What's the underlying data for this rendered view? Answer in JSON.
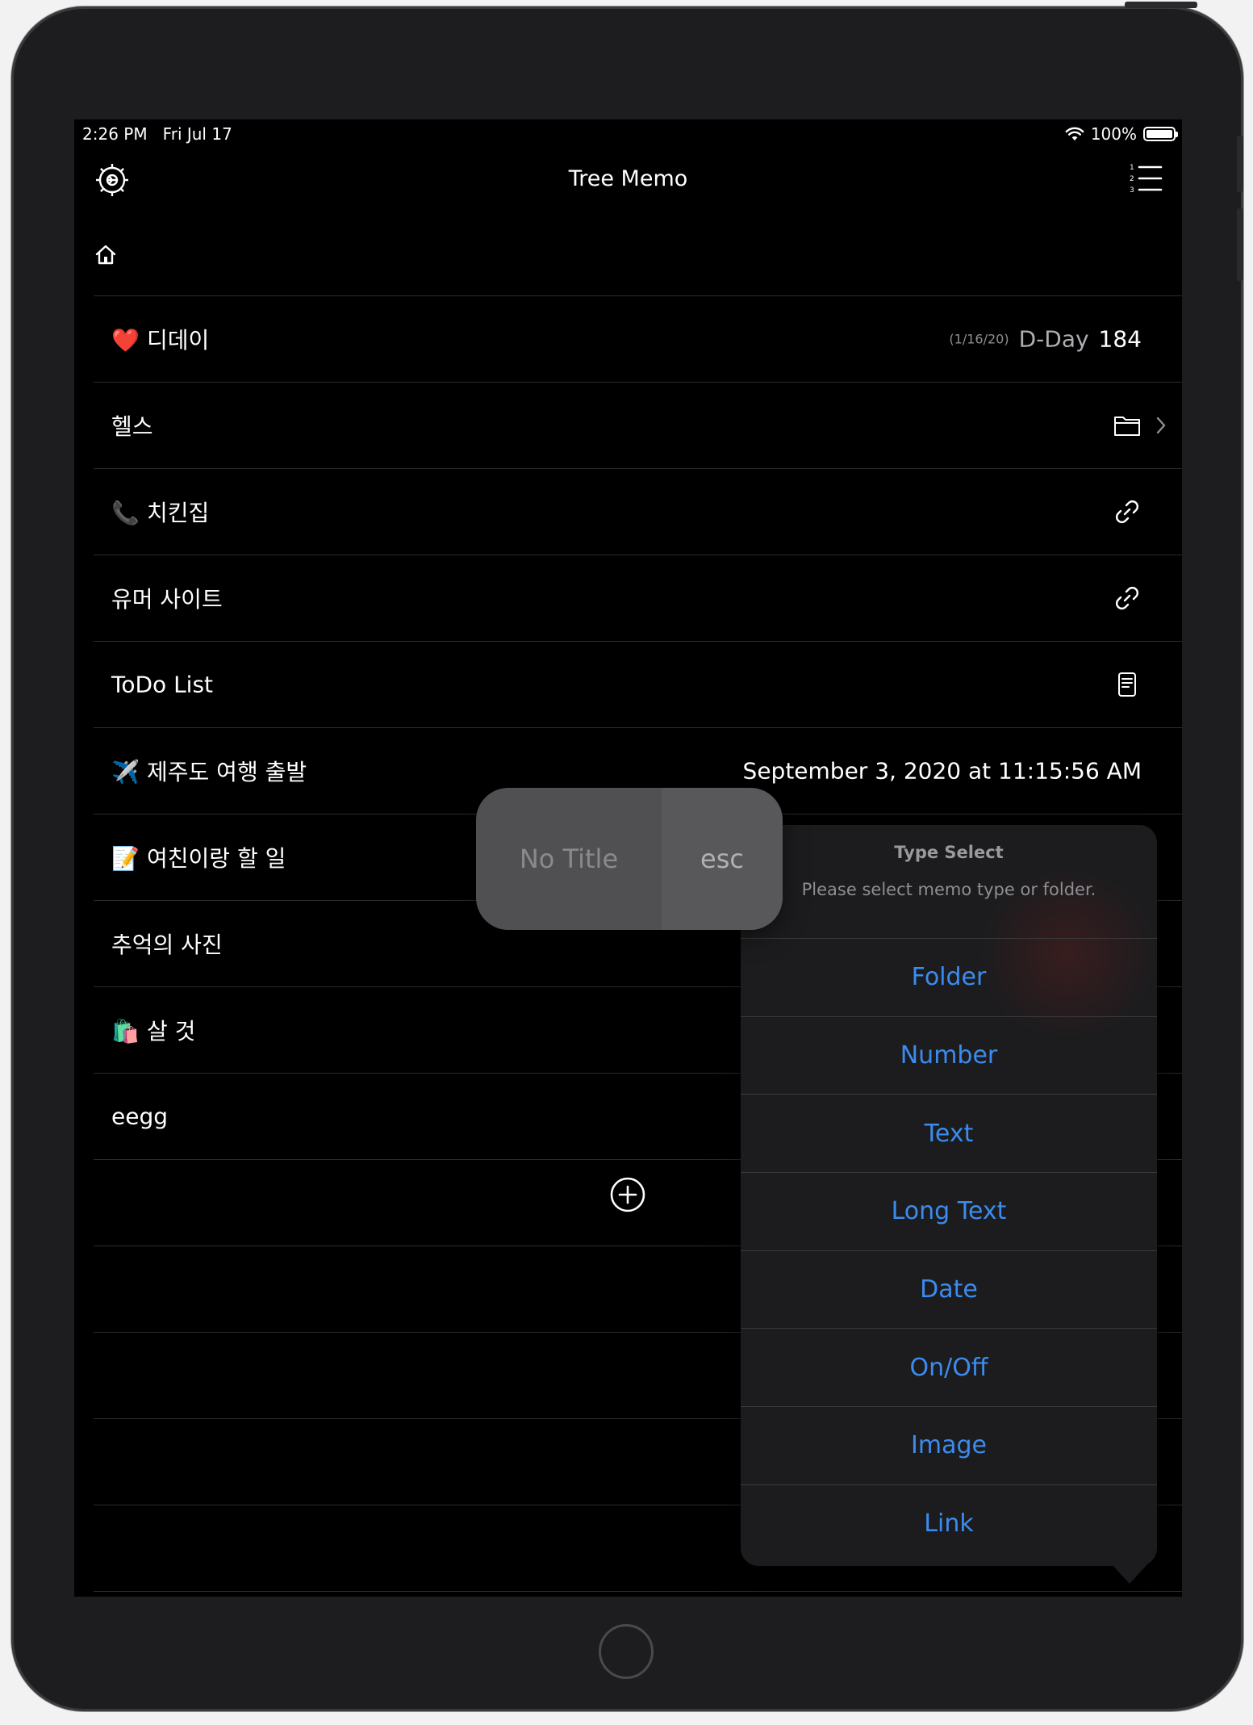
{
  "status_bar": {
    "time": "2:26 PM",
    "date": "Fri Jul 17",
    "battery": "100%",
    "battery_level": 1.0
  },
  "nav": {
    "title": "Tree Memo",
    "settings_icon": "gear-icon",
    "list_icon": "numbered-list-icon"
  },
  "breadcrumb": {
    "icon": "home-icon"
  },
  "memos": [
    {
      "emoji": "❤️",
      "title": "디데이",
      "date_note": "(1/16/20)",
      "dday_label": "D-Day",
      "dday_value": "184"
    },
    {
      "emoji": "",
      "title": "헬스",
      "icon": "folder-icon"
    },
    {
      "emoji": "📞",
      "title": "치킨집",
      "icon": "link-icon"
    },
    {
      "emoji": "",
      "title": "유머 사이트",
      "icon": "link-icon"
    },
    {
      "emoji": "",
      "title": "ToDo List",
      "icon": "document-icon"
    },
    {
      "emoji": "✈️",
      "title": "제주도 여행 출발",
      "date_value": "September 3, 2020 at 11:15:56 AM"
    },
    {
      "emoji": "📝",
      "title": "여친이랑 할 일"
    },
    {
      "emoji": "",
      "title": "추억의 사진"
    },
    {
      "emoji": "🛍️",
      "title": "살 것"
    },
    {
      "emoji": "",
      "title": "eegg"
    }
  ],
  "rename_popup": {
    "title_placeholder": "No Title",
    "esc_label": "esc"
  },
  "type_select": {
    "title": "Type Select",
    "message": "Please select memo type or folder.",
    "options": [
      "Folder",
      "Number",
      "Text",
      "Long Text",
      "Date",
      "On/Off",
      "Image",
      "Link"
    ]
  },
  "colors": {
    "accent": "#3b8cf0",
    "background": "#000000",
    "sheet": "#1c1c1e",
    "separator": "#2c2c2e"
  }
}
